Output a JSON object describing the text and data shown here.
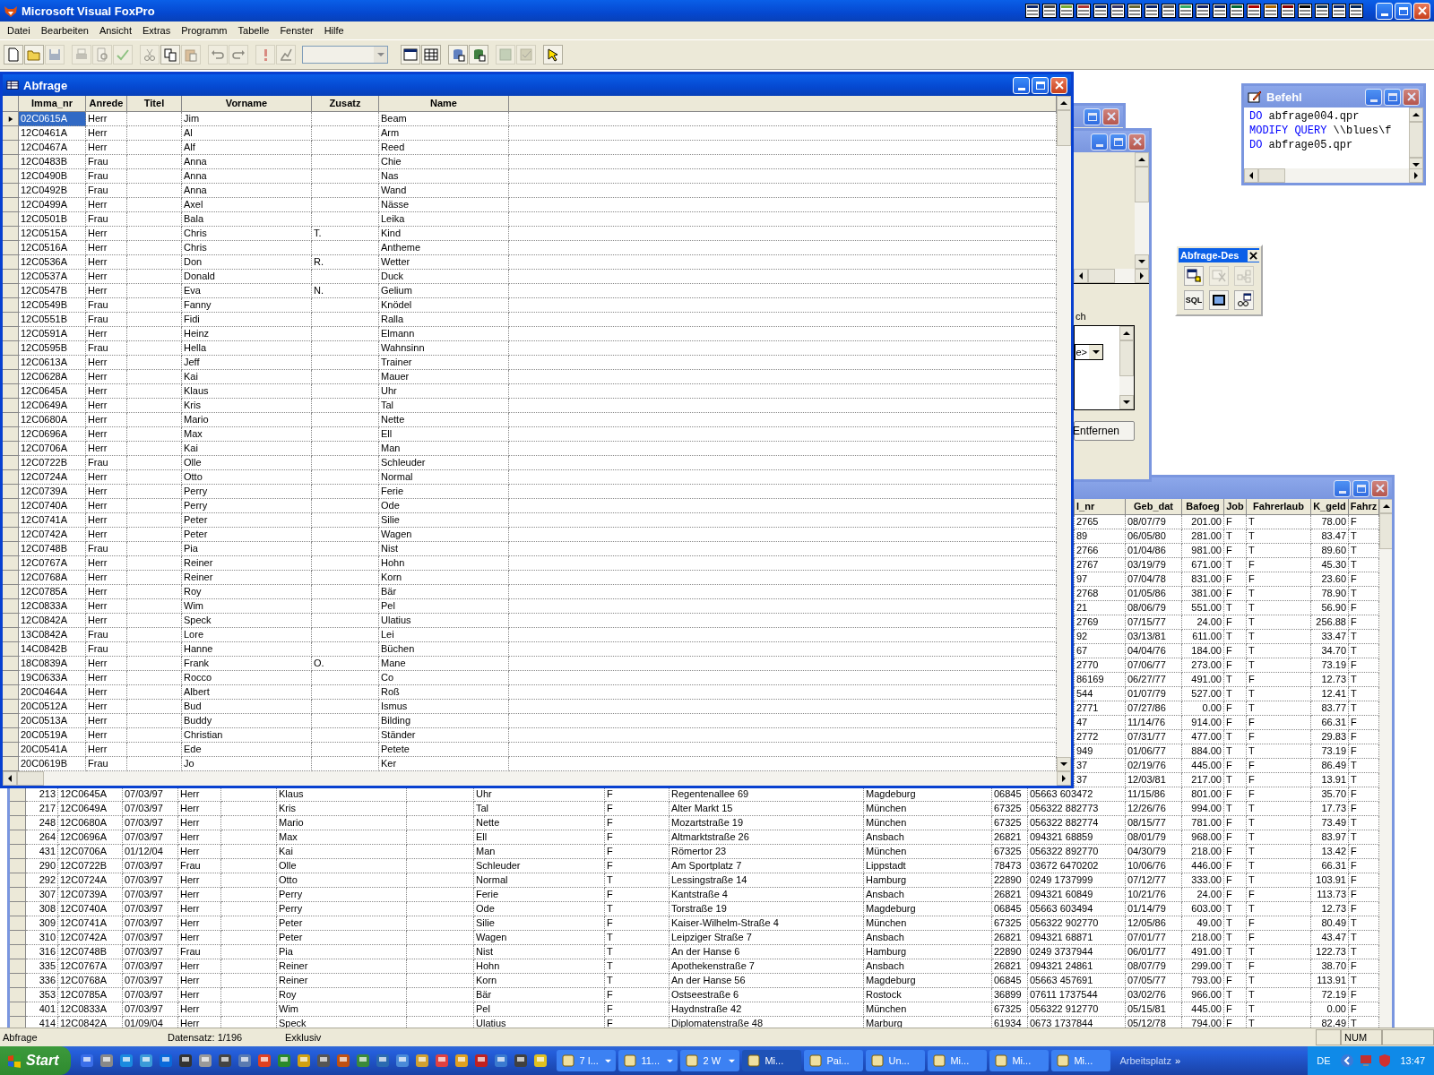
{
  "window": {
    "title": "Microsoft Visual FoxPro"
  },
  "menu": [
    "Datei",
    "Bearbeiten",
    "Ansicht",
    "Extras",
    "Programm",
    "Tabelle",
    "Fenster",
    "Hilfe"
  ],
  "toolbar": [
    {
      "kind": "button",
      "disabled": false
    },
    {
      "kind": "button",
      "disabled": false
    },
    {
      "kind": "button",
      "disabled": true
    },
    {
      "kind": "button",
      "disabled": true
    },
    {
      "kind": "button",
      "disabled": true
    },
    {
      "kind": "button",
      "disabled": true
    },
    {
      "kind": "button",
      "disabled": true
    },
    {
      "kind": "button",
      "disabled": false
    },
    {
      "kind": "button",
      "disabled": true
    },
    {
      "kind": "button",
      "disabled": true
    },
    {
      "kind": "button",
      "disabled": true
    },
    {
      "kind": "button",
      "disabled": true
    },
    {
      "kind": "button",
      "disabled": true
    },
    {
      "kind": "combo",
      "disabled": true
    },
    {
      "kind": "button",
      "disabled": false
    },
    {
      "kind": "button",
      "disabled": false
    },
    {
      "kind": "button",
      "disabled": false
    },
    {
      "kind": "button",
      "disabled": false
    },
    {
      "kind": "button",
      "disabled": true
    },
    {
      "kind": "button",
      "disabled": true
    },
    {
      "kind": "button",
      "disabled": false
    }
  ],
  "abfrage_window": {
    "title": "Abfrage",
    "columns": [
      "Imma_nr",
      "Anrede",
      "Titel",
      "Vorname",
      "Zusatz",
      "Name"
    ],
    "rows": [
      {
        "imma_nr": "02C0615A",
        "anrede": "Herr",
        "vorname": "Jim",
        "name": "Beam",
        "selected": true
      },
      {
        "imma_nr": "12C0461A",
        "anrede": "Herr",
        "vorname": "Al",
        "name": "Arm",
        "selected": false
      },
      {
        "imma_nr": "12C0467A",
        "anrede": "Herr",
        "vorname": "Alf",
        "name": "Reed",
        "selected": false
      },
      {
        "imma_nr": "12C0483B",
        "anrede": "Frau",
        "vorname": "Anna",
        "name": "Chie",
        "selected": false
      },
      {
        "imma_nr": "12C0490B",
        "anrede": "Frau",
        "vorname": "Anna",
        "name": "Nas",
        "selected": false
      },
      {
        "imma_nr": "12C0492B",
        "anrede": "Frau",
        "vorname": "Anna",
        "name": "Wand",
        "selected": false
      },
      {
        "imma_nr": "12C0499A",
        "anrede": "Herr",
        "vorname": "Axel",
        "name": "Nässe",
        "selected": false
      },
      {
        "imma_nr": "12C0501B",
        "anrede": "Frau",
        "vorname": "Bala",
        "name": "Leika",
        "selected": false
      },
      {
        "imma_nr": "12C0515A",
        "anrede": "Herr",
        "vorname": "Chris",
        "zusatz": "T.",
        "name": "Kind",
        "selected": false
      },
      {
        "imma_nr": "12C0516A",
        "anrede": "Herr",
        "vorname": "Chris",
        "name": "Antheme",
        "selected": false
      },
      {
        "imma_nr": "12C0536A",
        "anrede": "Herr",
        "vorname": "Don",
        "zusatz": "R.",
        "name": "Wetter",
        "selected": false
      },
      {
        "imma_nr": "12C0537A",
        "anrede": "Herr",
        "vorname": "Donald",
        "name": "Duck",
        "selected": false
      },
      {
        "imma_nr": "12C0547B",
        "anrede": "Herr",
        "vorname": "Eva",
        "zusatz": "N.",
        "name": "Gelium",
        "selected": false
      },
      {
        "imma_nr": "12C0549B",
        "anrede": "Frau",
        "vorname": "Fanny",
        "name": "Knödel",
        "selected": false
      },
      {
        "imma_nr": "12C0551B",
        "anrede": "Frau",
        "vorname": "Fidi",
        "name": "Ralla",
        "selected": false
      },
      {
        "imma_nr": "12C0591A",
        "anrede": "Herr",
        "vorname": "Heinz",
        "name": "Elmann",
        "selected": false
      },
      {
        "imma_nr": "12C0595B",
        "anrede": "Frau",
        "vorname": "Hella",
        "name": "Wahnsinn",
        "selected": false
      },
      {
        "imma_nr": "12C0613A",
        "anrede": "Herr",
        "vorname": "Jeff",
        "name": "Trainer",
        "selected": false
      },
      {
        "imma_nr": "12C0628A",
        "anrede": "Herr",
        "vorname": "Kai",
        "name": "Mauer",
        "selected": false
      },
      {
        "imma_nr": "12C0645A",
        "anrede": "Herr",
        "vorname": "Klaus",
        "name": "Uhr",
        "selected": false
      },
      {
        "imma_nr": "12C0649A",
        "anrede": "Herr",
        "vorname": "Kris",
        "name": "Tal",
        "selected": false
      },
      {
        "imma_nr": "12C0680A",
        "anrede": "Herr",
        "vorname": "Mario",
        "name": "Nette",
        "selected": false
      },
      {
        "imma_nr": "12C0696A",
        "anrede": "Herr",
        "vorname": "Max",
        "name": "Ell",
        "selected": false
      },
      {
        "imma_nr": "12C0706A",
        "anrede": "Herr",
        "vorname": "Kai",
        "name": "Man",
        "selected": false
      },
      {
        "imma_nr": "12C0722B",
        "anrede": "Frau",
        "vorname": "Olle",
        "name": "Schleuder",
        "selected": false
      },
      {
        "imma_nr": "12C0724A",
        "anrede": "Herr",
        "vorname": "Otto",
        "name": "Normal",
        "selected": false
      },
      {
        "imma_nr": "12C0739A",
        "anrede": "Herr",
        "vorname": "Perry",
        "name": "Ferie",
        "selected": false
      },
      {
        "imma_nr": "12C0740A",
        "anrede": "Herr",
        "vorname": "Perry",
        "name": "Ode",
        "selected": false
      },
      {
        "imma_nr": "12C0741A",
        "anrede": "Herr",
        "vorname": "Peter",
        "name": "Silie",
        "selected": false
      },
      {
        "imma_nr": "12C0742A",
        "anrede": "Herr",
        "vorname": "Peter",
        "name": "Wagen",
        "selected": false
      },
      {
        "imma_nr": "12C0748B",
        "anrede": "Frau",
        "vorname": "Pia",
        "name": "Nist",
        "selected": false
      },
      {
        "imma_nr": "12C0767A",
        "anrede": "Herr",
        "vorname": "Reiner",
        "name": "Hohn",
        "selected": false
      },
      {
        "imma_nr": "12C0768A",
        "anrede": "Herr",
        "vorname": "Reiner",
        "name": "Korn",
        "selected": false
      },
      {
        "imma_nr": "12C0785A",
        "anrede": "Herr",
        "vorname": "Roy",
        "name": "Bär",
        "selected": false
      },
      {
        "imma_nr": "12C0833A",
        "anrede": "Herr",
        "vorname": "Wim",
        "name": "Pel",
        "selected": false
      },
      {
        "imma_nr": "12C0842A",
        "anrede": "Herr",
        "vorname": "Speck",
        "name": "Ulatius",
        "selected": false
      },
      {
        "imma_nr": "13C0842A",
        "anrede": "Frau",
        "vorname": "Lore",
        "name": "Lei",
        "selected": false
      },
      {
        "imma_nr": "14C0842B",
        "anrede": "Frau",
        "vorname": "Hanne",
        "name": "Büchen",
        "selected": false
      },
      {
        "imma_nr": "18C0839A",
        "anrede": "Herr",
        "vorname": "Frank",
        "zusatz": "O.",
        "name": "Mane",
        "selected": false
      },
      {
        "imma_nr": "19C0633A",
        "anrede": "Herr",
        "vorname": "Rocco",
        "name": "Co",
        "selected": false
      },
      {
        "imma_nr": "20C0464A",
        "anrede": "Herr",
        "vorname": "Albert",
        "name": "Roß",
        "selected": false
      },
      {
        "imma_nr": "20C0512A",
        "anrede": "Herr",
        "vorname": "Bud",
        "name": "Ismus",
        "selected": false
      },
      {
        "imma_nr": "20C0513A",
        "anrede": "Herr",
        "vorname": "Buddy",
        "name": "Bilding",
        "selected": false
      },
      {
        "imma_nr": "20C0519A",
        "anrede": "Herr",
        "vorname": "Christian",
        "name": "Ständer",
        "selected": false
      },
      {
        "imma_nr": "20C0541A",
        "anrede": "Herr",
        "vorname": "Ede",
        "name": "Petete",
        "selected": false
      },
      {
        "imma_nr": "20C0619B",
        "anrede": "Frau",
        "vorname": "Jo",
        "name": "Ker",
        "selected": false
      }
    ]
  },
  "table_window": {
    "columns": [
      "l_nr",
      "Geb_dat",
      "Bafoeg",
      "Job",
      "Fahrerlaub",
      "K_geld",
      "Fahrz"
    ],
    "rows_partly_hidden": [
      {
        "column_13": "2765",
        "geb_dat": "08/07/79",
        "bafoeg": "201.00",
        "job": "F",
        "fahrerlaub": "T",
        "k_geld": "78.00",
        "fahrz": "F"
      },
      {
        "column_13": "89",
        "geb_dat": "06/05/80",
        "bafoeg": "281.00",
        "job": "T",
        "fahrerlaub": "T",
        "k_geld": "83.47",
        "fahrz": "T"
      },
      {
        "column_13": "2766",
        "geb_dat": "01/04/86",
        "bafoeg": "981.00",
        "job": "F",
        "fahrerlaub": "T",
        "k_geld": "89.60",
        "fahrz": "T"
      },
      {
        "column_13": "2767",
        "geb_dat": "03/19/79",
        "bafoeg": "671.00",
        "job": "T",
        "fahrerlaub": "F",
        "k_geld": "45.30",
        "fahrz": "T"
      },
      {
        "column_13": "97",
        "geb_dat": "07/04/78",
        "bafoeg": "831.00",
        "job": "F",
        "fahrerlaub": "F",
        "k_geld": "23.60",
        "fahrz": "F"
      },
      {
        "column_13": "2768",
        "geb_dat": "01/05/86",
        "bafoeg": "381.00",
        "job": "F",
        "fahrerlaub": "T",
        "k_geld": "78.90",
        "fahrz": "T"
      },
      {
        "column_13": "21",
        "geb_dat": "08/06/79",
        "bafoeg": "551.00",
        "job": "T",
        "fahrerlaub": "T",
        "k_geld": "56.90",
        "fahrz": "F"
      },
      {
        "column_13": "2769",
        "geb_dat": "07/15/77",
        "bafoeg": "24.00",
        "job": "F",
        "fahrerlaub": "T",
        "k_geld": "256.88",
        "fahrz": "F"
      },
      {
        "column_13": "92",
        "geb_dat": "03/13/81",
        "bafoeg": "611.00",
        "job": "T",
        "fahrerlaub": "T",
        "k_geld": "33.47",
        "fahrz": "T"
      },
      {
        "column_13": "67",
        "geb_dat": "04/04/76",
        "bafoeg": "184.00",
        "job": "F",
        "fahrerlaub": "T",
        "k_geld": "34.70",
        "fahrz": "T"
      },
      {
        "column_13": "2770",
        "geb_dat": "07/06/77",
        "bafoeg": "273.00",
        "job": "F",
        "fahrerlaub": "T",
        "k_geld": "73.19",
        "fahrz": "F"
      },
      {
        "column_13": "86169",
        "geb_dat": "06/27/77",
        "bafoeg": "491.00",
        "job": "T",
        "fahrerlaub": "F",
        "k_geld": "12.73",
        "fahrz": "T"
      },
      {
        "column_13": "544",
        "geb_dat": "01/07/79",
        "bafoeg": "527.00",
        "job": "T",
        "fahrerlaub": "T",
        "k_geld": "12.41",
        "fahrz": "T"
      },
      {
        "column_13": "2771",
        "geb_dat": "07/27/86",
        "bafoeg": "0.00",
        "job": "F",
        "fahrerlaub": "T",
        "k_geld": "83.77",
        "fahrz": "T"
      },
      {
        "column_13": "47",
        "geb_dat": "11/14/76",
        "bafoeg": "914.00",
        "job": "F",
        "fahrerlaub": "F",
        "k_geld": "66.31",
        "fahrz": "F"
      },
      {
        "column_13": "2772",
        "geb_dat": "07/31/77",
        "bafoeg": "477.00",
        "job": "T",
        "fahrerlaub": "F",
        "k_geld": "29.83",
        "fahrz": "F"
      },
      {
        "column_13": "949",
        "geb_dat": "01/06/77",
        "bafoeg": "884.00",
        "job": "T",
        "fahrerlaub": "T",
        "k_geld": "73.19",
        "fahrz": "F"
      },
      {
        "column_13": "37",
        "geb_dat": "02/19/76",
        "bafoeg": "445.00",
        "job": "F",
        "fahrerlaub": "F",
        "k_geld": "86.49",
        "fahrz": "T"
      },
      {
        "column_13": "37",
        "geb_dat": "12/03/81",
        "bafoeg": "217.00",
        "job": "T",
        "fahrerlaub": "F",
        "k_geld": "13.91",
        "fahrz": "T"
      }
    ],
    "rows": [
      {
        "column_1": "213",
        "column_2": "12C0645A",
        "column_3": "07/03/97",
        "column_4": "Herr",
        "column_6": "Klaus",
        "column_8": "Uhr",
        "column_9": "F",
        "column_10": "Regentenallee 69",
        "column_11": "Magdeburg",
        "column_12": "06845",
        "column_13": "05663 603472",
        "geb_dat": "11/15/86",
        "bafoeg": "801.00",
        "job": "F",
        "fahrerlaub": "F",
        "k_geld": "35.70",
        "fahrz": "F"
      },
      {
        "column_1": "217",
        "column_2": "12C0649A",
        "column_3": "07/03/97",
        "column_4": "Herr",
        "column_6": "Kris",
        "column_8": "Tal",
        "column_9": "F",
        "column_10": "Alter Markt 15",
        "column_11": "München",
        "column_12": "67325",
        "column_13": "056322 882773",
        "geb_dat": "12/26/76",
        "bafoeg": "994.00",
        "job": "T",
        "fahrerlaub": "T",
        "k_geld": "17.73",
        "fahrz": "F"
      },
      {
        "column_1": "248",
        "column_2": "12C0680A",
        "column_3": "07/03/97",
        "column_4": "Herr",
        "column_6": "Mario",
        "column_8": "Nette",
        "column_9": "F",
        "column_10": "Mozartstraße 19",
        "column_11": "München",
        "column_12": "67325",
        "column_13": "056322 882774",
        "geb_dat": "08/15/77",
        "bafoeg": "781.00",
        "job": "F",
        "fahrerlaub": "T",
        "k_geld": "73.49",
        "fahrz": "T"
      },
      {
        "column_1": "264",
        "column_2": "12C0696A",
        "column_3": "07/03/97",
        "column_4": "Herr",
        "column_6": "Max",
        "column_8": "Ell",
        "column_9": "F",
        "column_10": "Altmarktstraße 26",
        "column_11": "Ansbach",
        "column_12": "26821",
        "column_13": "094321 68859",
        "geb_dat": "08/01/79",
        "bafoeg": "968.00",
        "job": "F",
        "fahrerlaub": "T",
        "k_geld": "83.97",
        "fahrz": "T"
      },
      {
        "column_1": "431",
        "column_2": "12C0706A",
        "column_3": "01/12/04",
        "column_4": "Herr",
        "column_6": "Kai",
        "column_8": "Man",
        "column_9": "F",
        "column_10": "Römertor 23",
        "column_11": "München",
        "column_12": "67325",
        "column_13": "056322 892770",
        "geb_dat": "04/30/79",
        "bafoeg": "218.00",
        "job": "F",
        "fahrerlaub": "T",
        "k_geld": "13.42",
        "fahrz": "F"
      },
      {
        "column_1": "290",
        "column_2": "12C0722B",
        "column_3": "07/03/97",
        "column_4": "Frau",
        "column_6": "Olle",
        "column_8": "Schleuder",
        "column_9": "F",
        "column_10": "Am Sportplatz 7",
        "column_11": "Lippstadt",
        "column_12": "78473",
        "column_13": "03672 6470202",
        "geb_dat": "10/06/76",
        "bafoeg": "446.00",
        "job": "F",
        "fahrerlaub": "T",
        "k_geld": "66.31",
        "fahrz": "F"
      },
      {
        "column_1": "292",
        "column_2": "12C0724A",
        "column_3": "07/03/97",
        "column_4": "Herr",
        "column_6": "Otto",
        "column_8": "Normal",
        "column_9": "T",
        "column_10": "Lessingstraße 14",
        "column_11": "Hamburg",
        "column_12": "22890",
        "column_13": "0249 1737999",
        "geb_dat": "07/12/77",
        "bafoeg": "333.00",
        "job": "F",
        "fahrerlaub": "T",
        "k_geld": "103.91",
        "fahrz": "F"
      },
      {
        "column_1": "307",
        "column_2": "12C0739A",
        "column_3": "07/03/97",
        "column_4": "Herr",
        "column_6": "Perry",
        "column_8": "Ferie",
        "column_9": "F",
        "column_10": "Kantstraße 4",
        "column_11": "Ansbach",
        "column_12": "26821",
        "column_13": "094321 60849",
        "geb_dat": "10/21/76",
        "bafoeg": "24.00",
        "job": "F",
        "fahrerlaub": "F",
        "k_geld": "113.73",
        "fahrz": "F"
      },
      {
        "column_1": "308",
        "column_2": "12C0740A",
        "column_3": "07/03/97",
        "column_4": "Herr",
        "column_6": "Perry",
        "column_8": "Ode",
        "column_9": "T",
        "column_10": "Torstraße 19",
        "column_11": "Magdeburg",
        "column_12": "06845",
        "column_13": "05663 603494",
        "geb_dat": "01/14/79",
        "bafoeg": "603.00",
        "job": "T",
        "fahrerlaub": "T",
        "k_geld": "12.73",
        "fahrz": "F"
      },
      {
        "column_1": "309",
        "column_2": "12C0741A",
        "column_3": "07/03/97",
        "column_4": "Herr",
        "column_6": "Peter",
        "column_8": "Silie",
        "column_9": "F",
        "column_10": "Kaiser-Wilhelm-Straße 4",
        "column_11": "München",
        "column_12": "67325",
        "column_13": "056322 902770",
        "geb_dat": "12/05/86",
        "bafoeg": "49.00",
        "job": "T",
        "fahrerlaub": "F",
        "k_geld": "80.49",
        "fahrz": "T"
      },
      {
        "column_1": "310",
        "column_2": "12C0742A",
        "column_3": "07/03/97",
        "column_4": "Herr",
        "column_6": "Peter",
        "column_8": "Wagen",
        "column_9": "T",
        "column_10": "Leipziger Straße 7",
        "column_11": "Ansbach",
        "column_12": "26821",
        "column_13": "094321 68871",
        "geb_dat": "07/01/77",
        "bafoeg": "218.00",
        "job": "T",
        "fahrerlaub": "F",
        "k_geld": "43.47",
        "fahrz": "T"
      },
      {
        "column_1": "316",
        "column_2": "12C0748B",
        "column_3": "07/03/97",
        "column_4": "Frau",
        "column_6": "Pia",
        "column_8": "Nist",
        "column_9": "T",
        "column_10": "An der Hanse 6",
        "column_11": "Hamburg",
        "column_12": "22890",
        "column_13": "0249 3737944",
        "geb_dat": "06/01/77",
        "bafoeg": "491.00",
        "job": "T",
        "fahrerlaub": "T",
        "k_geld": "122.73",
        "fahrz": "T"
      },
      {
        "column_1": "335",
        "column_2": "12C0767A",
        "column_3": "07/03/97",
        "column_4": "Herr",
        "column_6": "Reiner",
        "column_8": "Hohn",
        "column_9": "T",
        "column_10": "Apothekenstraße 7",
        "column_11": "Ansbach",
        "column_12": "26821",
        "column_13": "094321 24861",
        "geb_dat": "08/07/79",
        "bafoeg": "299.00",
        "job": "T",
        "fahrerlaub": "F",
        "k_geld": "38.70",
        "fahrz": "F"
      },
      {
        "column_1": "336",
        "column_2": "12C0768A",
        "column_3": "07/03/97",
        "column_4": "Herr",
        "column_6": "Reiner",
        "column_8": "Korn",
        "column_9": "T",
        "column_10": "An der Hanse 56",
        "column_11": "Magdeburg",
        "column_12": "06845",
        "column_13": "05663 457691",
        "geb_dat": "07/05/77",
        "bafoeg": "793.00",
        "job": "F",
        "fahrerlaub": "T",
        "k_geld": "113.91",
        "fahrz": "T"
      },
      {
        "column_1": "353",
        "column_2": "12C0785A",
        "column_3": "07/03/97",
        "column_4": "Herr",
        "column_6": "Roy",
        "column_8": "Bär",
        "column_9": "F",
        "column_10": "Ostseestraße 6",
        "column_11": "Rostock",
        "column_12": "36899",
        "column_13": "07611 1737544",
        "geb_dat": "03/02/76",
        "bafoeg": "966.00",
        "job": "T",
        "fahrerlaub": "T",
        "k_geld": "72.19",
        "fahrz": "F"
      },
      {
        "column_1": "401",
        "column_2": "12C0833A",
        "column_3": "07/03/97",
        "column_4": "Herr",
        "column_6": "Wim",
        "column_8": "Pel",
        "column_9": "F",
        "column_10": "Haydnstraße 42",
        "column_11": "München",
        "column_12": "67325",
        "column_13": "056322 912770",
        "geb_dat": "05/15/81",
        "bafoeg": "445.00",
        "job": "F",
        "fahrerlaub": "T",
        "k_geld": "0.00",
        "fahrz": "F"
      },
      {
        "column_1": "414",
        "column_2": "12C0842A",
        "column_3": "01/09/04",
        "column_4": "Herr",
        "column_6": "Speck",
        "column_8": "Ulatius",
        "column_9": "F",
        "column_10": "Diplomatenstraße 48",
        "column_11": "Marburg",
        "column_12": "61934",
        "column_13": "0673 1737844",
        "geb_dat": "05/12/78",
        "bafoeg": "794.00",
        "job": "F",
        "fahrerlaub": "T",
        "k_geld": "82.49",
        "fahrz": "T"
      }
    ]
  },
  "back_window": {
    "label": "ch",
    "combo_value": "e>",
    "button": "Entfernen"
  },
  "befehl_window": {
    "title": "Befehl",
    "lines": [
      {
        "keyword": "DO",
        "text": "abfrage004.qpr"
      },
      {
        "keyword": "MODIFY QUERY",
        "text": "\\\\blues\\f"
      },
      {
        "keyword": "DO",
        "text": "abfrage05.qpr"
      }
    ]
  },
  "designer_toolbar": {
    "title": "Abfrage-Des",
    "buttons": [
      {
        "kind": "icon",
        "disabled": false
      },
      {
        "kind": "icon",
        "disabled": true
      },
      {
        "kind": "icon",
        "disabled": true
      },
      {
        "kind": "text",
        "label": "SQL",
        "disabled": false
      },
      {
        "kind": "icon",
        "disabled": false
      },
      {
        "kind": "icon",
        "disabled": false
      }
    ]
  },
  "status_bar": [
    "Abfrage",
    "Datensatz: 1/196",
    "Exklusiv",
    "NUM"
  ],
  "taskbar": {
    "start": "Start",
    "tasks": [
      {
        "label": "7 I...",
        "kind": "group",
        "selected": false
      },
      {
        "label": "11...",
        "kind": "group",
        "selected": false
      },
      {
        "label": "2 W",
        "kind": "group",
        "selected": false
      },
      {
        "label": "Mi...",
        "kind": "single",
        "selected": true
      },
      {
        "label": "Pai...",
        "kind": "single",
        "selected": false
      },
      {
        "label": "Un...",
        "kind": "single",
        "selected": false
      },
      {
        "label": "Mi...",
        "kind": "single",
        "selected": false
      },
      {
        "label": "Mi...",
        "kind": "single",
        "selected": false
      },
      {
        "label": "Mi...",
        "kind": "single",
        "selected": false
      }
    ],
    "toolbar_label": "Arbeitsplatz",
    "chevron": "»",
    "language": "DE",
    "clock": "13:47"
  }
}
